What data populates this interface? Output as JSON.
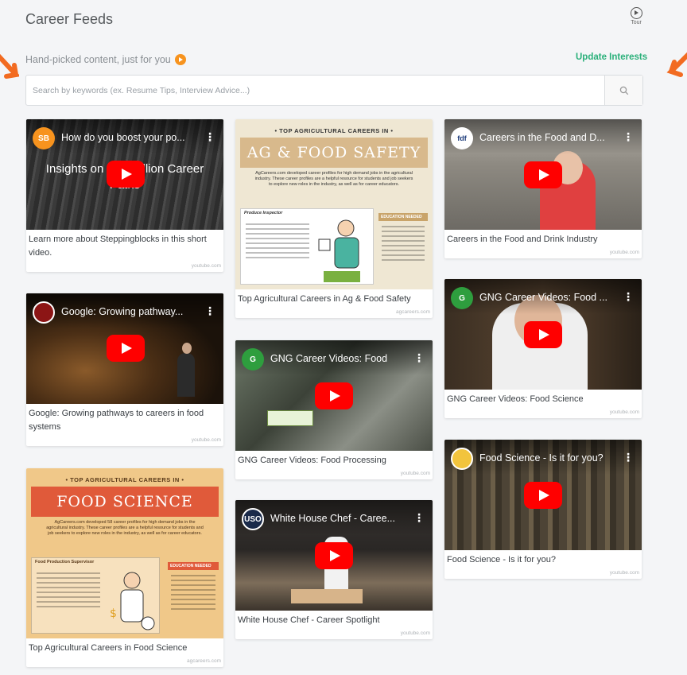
{
  "page": {
    "title": "Career Feeds",
    "tour_label": "Tour",
    "subtitle": "Hand-picked content, just for you",
    "update_link": "Update Interests"
  },
  "search": {
    "placeholder": "Search by keywords (ex. Resume Tips, Interview Advice...)"
  },
  "colors": {
    "accent_green": "#2ab07a",
    "accent_orange": "#f7931e",
    "youtube_red": "#ff0000"
  },
  "cards": [
    {
      "caption": "Learn more about Steppingblocks in this short video.",
      "source": "youtube.com",
      "video_title": "How do you boost your po...",
      "overlay": "Insights on 100 Million Career Paths",
      "logo_text": "SB"
    },
    {
      "caption": "Google: Growing pathways to careers in food systems",
      "source": "youtube.com",
      "video_title": "Google: Growing pathway...",
      "logo_text": ""
    },
    {
      "caption": "Top Agricultural Careers in Food Science",
      "source": "agcareers.com",
      "ig_top": "• TOP AGRICULTURAL CAREERS IN •",
      "ig_banner": "FOOD SCIENCE",
      "ig_desc": "AgCareers.com developed 58 career profiles for high demand jobs in the agricultural industry. These career profiles are a helpful resource for students and job seekers to explore new roles in the industry, as well as for career educators.",
      "ig_heading": "Food Production Supervisor",
      "ig_side": "EDUCATION NEEDED"
    },
    {
      "caption": "Top Agricultural Careers in Ag & Food Safety",
      "source": "agcareers.com",
      "ig_top": "• TOP AGRICULTURAL CAREERS IN •",
      "ig_banner": "AG & FOOD SAFETY",
      "ig_desc": "AgCareers.com developed career profiles for high demand jobs in the agricultural industry. These career profiles are a helpful resource for students and job seekers to explore new roles in the industry, as well as for career educators.",
      "ig_heading": "Produce Inspector",
      "ig_side": "EDUCATION NEEDED"
    },
    {
      "caption": "GNG Career Videos: Food Processing",
      "source": "youtube.com",
      "video_title": "GNG Career Videos: Food",
      "logo_text": "G"
    },
    {
      "caption": "White House Chef - Career Spotlight",
      "source": "youtube.com",
      "video_title": "White House Chef - Caree...",
      "logo_text": "USO"
    },
    {
      "caption": "Careers in the Food and Drink Industry",
      "source": "youtube.com",
      "video_title": "Careers in the Food and D...",
      "logo_text": "fdf"
    },
    {
      "caption": "GNG Career Videos: Food Science",
      "source": "youtube.com",
      "video_title": "GNG Career Videos: Food ...",
      "logo_text": "G"
    },
    {
      "caption": "Food Science - Is it for you?",
      "source": "youtube.com",
      "video_title": "Food Science - Is it for you?",
      "logo_text": ""
    }
  ]
}
